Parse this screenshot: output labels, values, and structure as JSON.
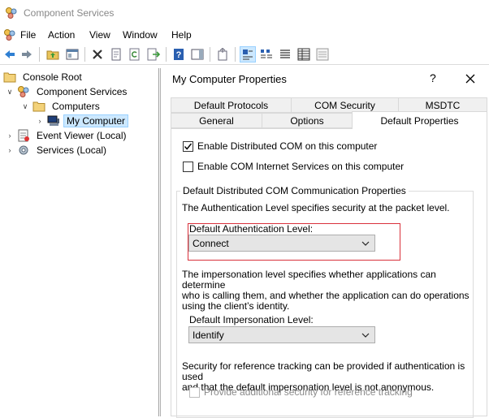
{
  "window": {
    "title": "Component Services"
  },
  "menu": [
    "File",
    "Action",
    "View",
    "Window",
    "Help"
  ],
  "toolbar": {
    "buttons": [
      "back-icon",
      "forward-icon",
      "up-folder-icon",
      "show-hide-tree-icon",
      "delete-icon",
      "properties-icon",
      "refresh-icon",
      "export-list-icon",
      "help-icon",
      "show-hide-action-pane-icon",
      "new-window-icon",
      "large-icons-view-icon",
      "small-icons-view-icon",
      "list-view-icon",
      "detail-view-icon",
      "status-view-icon"
    ]
  },
  "tree": {
    "items": [
      {
        "label": "Console Root",
        "level": 0,
        "expanded": null,
        "icon": "folder-icon"
      },
      {
        "label": "Component Services",
        "level": 1,
        "expanded": true,
        "icon": "component-services-icon"
      },
      {
        "label": "Computers",
        "level": 2,
        "expanded": true,
        "icon": "folder-icon"
      },
      {
        "label": "My Computer",
        "level": 3,
        "expanded": false,
        "icon": "computer-icon",
        "selected": true
      },
      {
        "label": "Event Viewer (Local)",
        "level": 1,
        "expanded": false,
        "icon": "event-viewer-icon"
      },
      {
        "label": "Services (Local)",
        "level": 1,
        "expanded": false,
        "icon": "services-icon"
      }
    ]
  },
  "dialog": {
    "title": "My Computer Properties",
    "help_glyph": "?",
    "tabs_row1": [
      "Default Protocols",
      "COM Security",
      "MSDTC"
    ],
    "tabs_row2": [
      "General",
      "Options",
      "Default Properties"
    ],
    "active_tab": "Default Properties",
    "enable_dcom": {
      "label": "Enable Distributed COM on this computer",
      "checked": true
    },
    "enable_cis": {
      "label": "Enable COM Internet Services on this computer",
      "checked": false
    },
    "group": {
      "legend": "Default Distributed COM Communication Properties",
      "auth_desc": "The Authentication Level specifies security at the packet level.",
      "auth_label": "Default Authentication Level:",
      "auth_value": "Connect",
      "imp_desc_lines": [
        "The impersonation level specifies whether applications can determine",
        "who is calling them, and whether the application can do operations",
        "using the client’s identity."
      ],
      "imp_label": "Default Impersonation Level:",
      "imp_value": "Identify",
      "ref_desc_lines": [
        "Security for reference tracking can be provided if authentication is used",
        "and that the default impersonation level is not anonymous."
      ],
      "ref_tracking": {
        "label": "Provide additional security for reference tracking",
        "checked": false,
        "enabled": false
      }
    }
  },
  "colors": {
    "highlight": "#d9313c",
    "selection": "#cce8ff",
    "accent_blue": "#1e6fc8"
  }
}
